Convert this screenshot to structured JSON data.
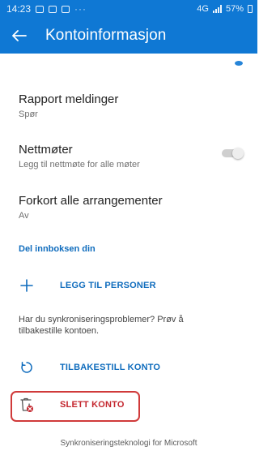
{
  "status_bar": {
    "time": "14:23",
    "overflow": "···",
    "network": "4G",
    "battery": "57%"
  },
  "app_bar": {
    "title": "Kontoinformasjon",
    "back_icon": "arrow-left-icon"
  },
  "settings": [
    {
      "title": "Rapport meldinger",
      "value": "Spør"
    },
    {
      "title": "Nettmøter",
      "value": "Legg til nettmøte for alle møter",
      "toggle": false
    },
    {
      "title": "Forkort alle arrangementer",
      "value": "Av"
    }
  ],
  "share_section": {
    "header": "Del innboksen din",
    "add_people": "LEGG TIL PERSONER",
    "add_icon": "plus-icon"
  },
  "sync": {
    "hint": "Har du synkroniseringsproblemer? Prøv å tilbakestille kontoen.",
    "reset_label": "TILBAKESTILL KONTO",
    "reset_icon": "refresh-icon"
  },
  "delete": {
    "label": "SLETT KONTO",
    "icon": "trash-delete-icon"
  },
  "footer": "Synkroniseringsteknologi for Microsoft",
  "colors": {
    "brand": "#0f78d4",
    "link": "#0f6cbd",
    "danger": "#c4262e",
    "highlight_border": "#d03a3a"
  }
}
